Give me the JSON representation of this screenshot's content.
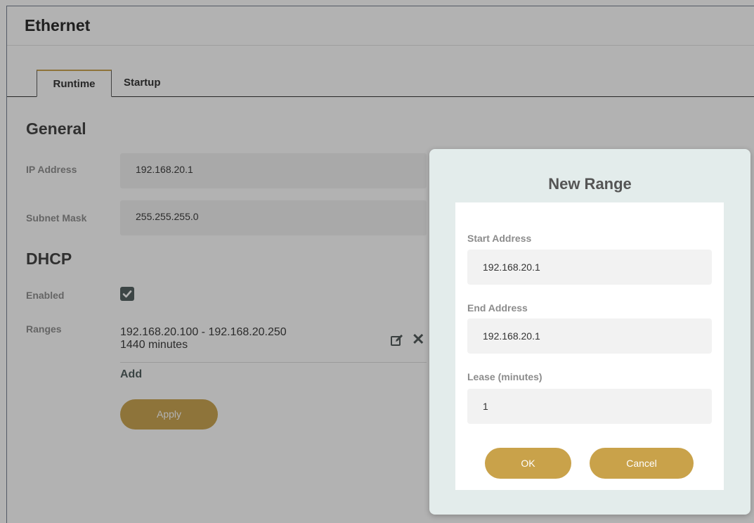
{
  "page": {
    "title": "Ethernet"
  },
  "tabs": [
    {
      "label": "Runtime",
      "active": true
    },
    {
      "label": "Startup",
      "active": false
    }
  ],
  "general": {
    "title": "General",
    "ip_label": "IP Address",
    "ip_value": "192.168.20.1",
    "subnet_label": "Subnet Mask",
    "subnet_value": "255.255.255.0"
  },
  "dhcp": {
    "title": "DHCP",
    "enabled_label": "Enabled",
    "enabled": true,
    "ranges_label": "Ranges",
    "ranges": [
      {
        "range": "192.168.20.100 - 192.168.20.250",
        "lease": "1440 minutes"
      }
    ],
    "add_label": "Add",
    "apply_label": "Apply"
  },
  "modal": {
    "title": "New Range",
    "start_label": "Start Address",
    "start_value": "192.168.20.1",
    "end_label": "End Address",
    "end_value": "192.168.20.1",
    "lease_label": "Lease (minutes)",
    "lease_value": "1",
    "ok_label": "OK",
    "cancel_label": "Cancel"
  },
  "colors": {
    "accent": "#c9a24a",
    "dark": "#4a5252"
  },
  "icons": {
    "edit": "edit-icon",
    "delete": "close-icon",
    "check": "check-icon"
  }
}
